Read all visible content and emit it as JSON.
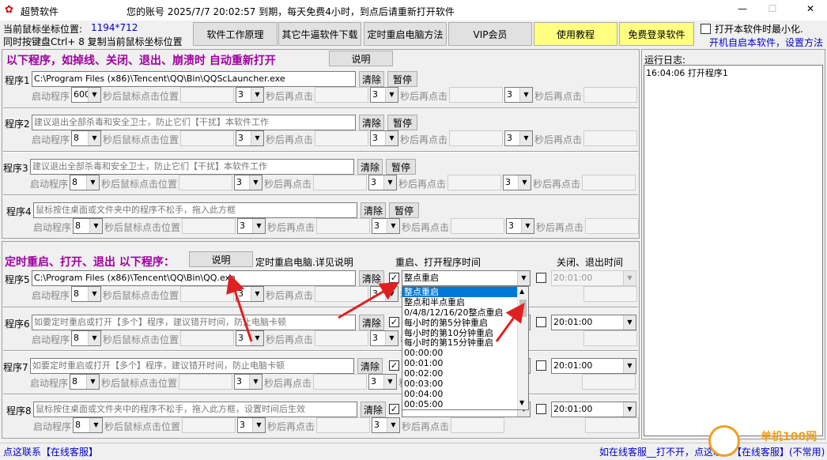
{
  "window": {
    "title": "超赞软件",
    "account_info": "您的账号 2025/7/7 20:02:57 到期，每天免费4小时，到点后请重新打开软件",
    "min": "—",
    "max": "☐",
    "close": "✕"
  },
  "coords": {
    "label": "当前鼠标坐标位置:",
    "value": "1194*712",
    "copy_hint": "同时按键盘Ctrl+ 8 复制当前鼠标坐标位置"
  },
  "top_buttons": {
    "principle": "软件工作原理",
    "other_download": "其它牛逼软件下载",
    "timed_restart": "定时重启电脑方法",
    "vip": "VIP会员",
    "tutorial": "使用教程",
    "free_login": "免费登录软件"
  },
  "startup": {
    "minimize": "打开本软件时最小化.",
    "autostart": "开机自启本软件，设置方法"
  },
  "section1": {
    "heading": "以下程序，如掉线、关闭、退出、崩溃时 自动重新打开",
    "explain": "说明"
  },
  "section2": {
    "heading": "定时重启、打开、退出 以下程序：",
    "explain": "说明",
    "detail": "定时重启电脑.详见说明",
    "col_restart": "重启、打开程序时间",
    "col_close": "关闭、退出时间"
  },
  "labels": {
    "clear": "清除",
    "pause": "暂停",
    "start_program": "启动程序",
    "sec_click_pos": "秒后鼠标点击位置",
    "sec_click_again": "秒后再点击"
  },
  "programs": [
    {
      "label": "程序1",
      "path": "C:\\Program Files (x86)\\Tencent\\QQ\\Bin\\QQScLauncher.exe",
      "delay": "600",
      "n1": "3",
      "n2": "3",
      "n3": "3"
    },
    {
      "label": "程序2",
      "path": "建议退出全部杀毒和安全卫士，防止它们【干扰】本软件工作",
      "delay": "8",
      "n1": "3",
      "n2": "3",
      "n3": "3"
    },
    {
      "label": "程序3",
      "path": "建议退出全部杀毒和安全卫士，防止它们【干扰】本软件工作",
      "delay": "8",
      "n1": "3",
      "n2": "3",
      "n3": "3"
    },
    {
      "label": "程序4",
      "path": "鼠标按住桌面或文件夹中的程序不松手，拖入此方框",
      "delay": "8",
      "n1": "3",
      "n2": "3",
      "n3": "3"
    }
  ],
  "timed_programs": [
    {
      "label": "程序5",
      "path": "C:\\Program Files (x86)\\Tencent\\QQ\\Bin\\QQ.exe",
      "delay": "8",
      "n1": "3",
      "n2": "3",
      "restart": "整点重启",
      "close_time": "20:01:00"
    },
    {
      "label": "程序6",
      "path": "如要定时重启或打开【多个】程序，建议错开时间，防止电脑卡顿",
      "delay": "8",
      "n1": "3",
      "n2": "3",
      "restart": "",
      "close_time": "20:01:00"
    },
    {
      "label": "程序7",
      "path": "如要定时重启或打开【多个】程序，建议错开时间，防止电脑卡顿",
      "delay": "8",
      "n1": "3",
      "n2": "3",
      "restart": "",
      "close_time": "20:01:00"
    },
    {
      "label": "程序8",
      "path": "鼠标按住桌面或文件夹中的程序不松手，拖入此方框，设置时间后生效",
      "delay": "8",
      "n1": "3",
      "n2": "3",
      "restart": "",
      "close_time": "20:01:00"
    }
  ],
  "dropdown": {
    "options": [
      "整点重启",
      "整点和半点重启",
      "0/4/8/12/16/20整点重启",
      "每小时的第5分钟重启",
      "每小时的第10分钟重启",
      "每小时的第15分钟重启",
      "00:00:00",
      "00:01:00",
      "00:02:00",
      "00:03:00",
      "00:04:00",
      "00:05:00"
    ],
    "selected": "整点重启"
  },
  "log": {
    "label": "运行日志:",
    "entries": [
      "16:04:06 打开程序1"
    ]
  },
  "footer": {
    "left": "点这联系【在线客服】",
    "right": "如在线客服__打不开，点这联系【在线客服】(不常用)",
    "watermark": "单机100网"
  },
  "colors": {
    "accent_red": "#cc0000",
    "heading_purple": "#a000a0",
    "link_blue": "#0000cc",
    "yellow_button": "#ffff80"
  }
}
